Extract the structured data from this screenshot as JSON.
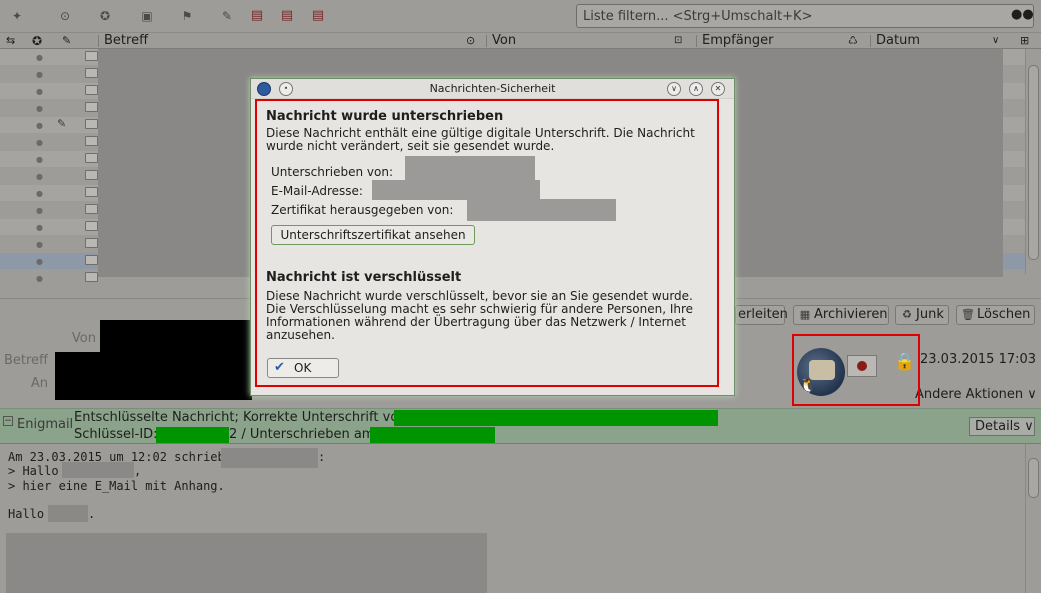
{
  "toolbar": {
    "filter_placeholder": "Liste filtern... <Strg+Umschalt+K>",
    "icons": [
      "pin-icon",
      "unread-icon",
      "star-icon",
      "contact-icon",
      "tag-icon",
      "attachment-icon",
      "calendar-icon",
      "calendar-icon",
      "calendar-icon"
    ]
  },
  "columns": {
    "subject": "Betreff",
    "from": "Von",
    "recipient": "Empfänger",
    "date": "Datum"
  },
  "header": {
    "from_label": "Von",
    "subject_label": "Betreff",
    "to_label": "An",
    "forward_label": "erleiten",
    "archive_label": "Archivieren",
    "junk_label": "Junk",
    "delete_label": "Löschen",
    "date": "23.03.2015 17:03",
    "more_actions": "Andere Aktionen"
  },
  "enigmail": {
    "label": "Enigmail",
    "line1": "Entschlüsselte Nachricht; Korrekte Unterschrift von",
    "line2_prefix": "Schlüssel-ID:",
    "line2_suffix": "2 / Unterschrieben am:",
    "details": "Details"
  },
  "body": {
    "line1_a": "Am 23.03.2015 um 12:02 schrieb",
    "line1_b": ":",
    "line2_a": "> Hallo",
    "line2_b": ",",
    "line3": "> hier eine E_Mail mit Anhang.",
    "line5_a": "Hallo",
    "line5_b": "."
  },
  "dialog": {
    "title": "Nachrichten-Sicherheit",
    "signed_heading": "Nachricht wurde unterschrieben",
    "signed_text": "Diese Nachricht enthält eine gültige digitale Unterschrift. Die Nachricht wurde nicht verändert, seit sie gesendet wurde.",
    "signed_by_label": "Unterschrieben von:",
    "email_label": "E-Mail-Adresse:",
    "issuer_label": "Zertifikat herausgegeben von:",
    "view_cert_button": "Unterschriftszertifikat ansehen",
    "encrypted_heading": "Nachricht ist verschlüsselt",
    "encrypted_text": "Diese Nachricht wurde verschlüsselt, bevor sie an Sie gesendet wurde. Die Verschlüsselung macht es sehr schwierig für andere Personen, Ihre Informationen während der Übertragung über das Netzwerk / Internet anzusehen.",
    "ok_button": "OK"
  },
  "colors": {
    "annotation_red": "#e00000",
    "enigmail_green": "#009400",
    "background_dim": "#9e9c99",
    "dialog_bg": "#e7e5e2"
  }
}
